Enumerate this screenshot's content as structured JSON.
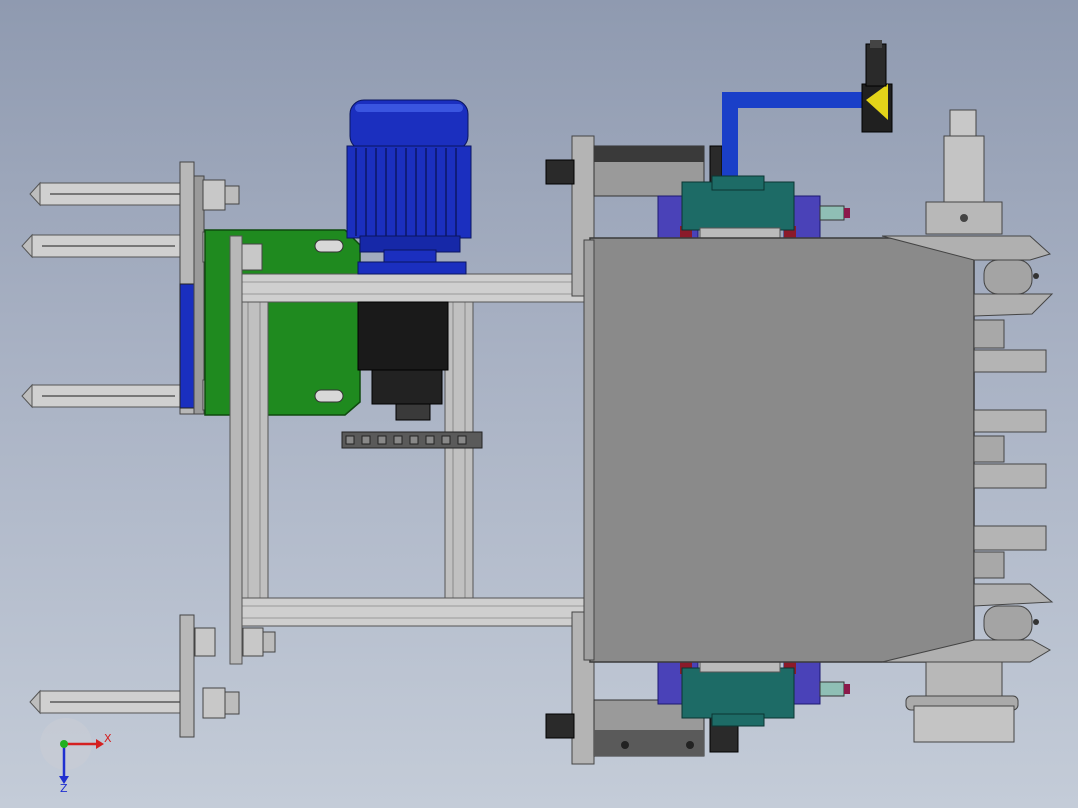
{
  "scene": {
    "description_visible_text": [],
    "colors": {
      "background_top": "#8f9ab0",
      "background_bottom": "#c4ccd8",
      "motor_blue": "#1b2fbf",
      "motor_blue_light": "#3a55e0",
      "plate_green": "#1f8a1f",
      "housing_gray": "#8a8a8a",
      "steel_light": "#d4d4d4",
      "steel_mid": "#a8a8a8",
      "bearing_teal": "#1d6b66",
      "bracket_purple": "#4a42b8",
      "seal_red": "#8b1a2a",
      "gearbox_black": "#1a1a1a",
      "hose_blue": "#1a3fc8",
      "valve_yellow": "#e3d419"
    }
  },
  "triad": {
    "x_label": "X",
    "z_label": "Z",
    "x_color": "#d42020",
    "y_color": "#20b020",
    "z_color": "#2030d0"
  }
}
